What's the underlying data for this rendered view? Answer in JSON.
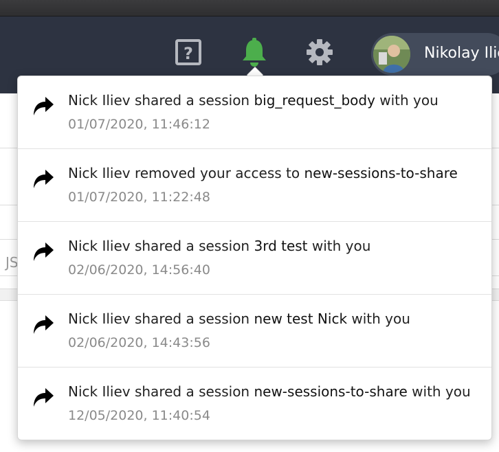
{
  "colors": {
    "navbar": "#2d3341",
    "bell_active": "#4cae4c",
    "icon_gray": "#b5b8bf"
  },
  "header": {
    "icons": [
      "help-icon",
      "bell-icon",
      "gear-icon"
    ],
    "user_name": "Nikolay Ilie"
  },
  "background": {
    "stub_text": "JS"
  },
  "notifications": [
    {
      "icon": "share-icon",
      "prefix": "Nick Iliev shared a session ",
      "target": "big_request_body",
      "suffix": " with you",
      "time": "01/07/2020, 11:46:12"
    },
    {
      "icon": "share-icon",
      "prefix": "Nick Iliev removed your access to ",
      "target": "new-sessions-to-share",
      "suffix": "",
      "time": "01/07/2020, 11:22:48"
    },
    {
      "icon": "share-icon",
      "prefix": "Nick Iliev shared a session ",
      "target": "3rd test",
      "suffix": " with you",
      "time": "02/06/2020, 14:56:40"
    },
    {
      "icon": "share-icon",
      "prefix": "Nick Iliev shared a session ",
      "target": "new test Nick",
      "suffix": " with you",
      "time": "02/06/2020, 14:43:56"
    },
    {
      "icon": "share-icon",
      "prefix": "Nick Iliev shared a session ",
      "target": "new-sessions-to-share",
      "suffix": " with you",
      "time": "12/05/2020, 11:40:54"
    }
  ]
}
